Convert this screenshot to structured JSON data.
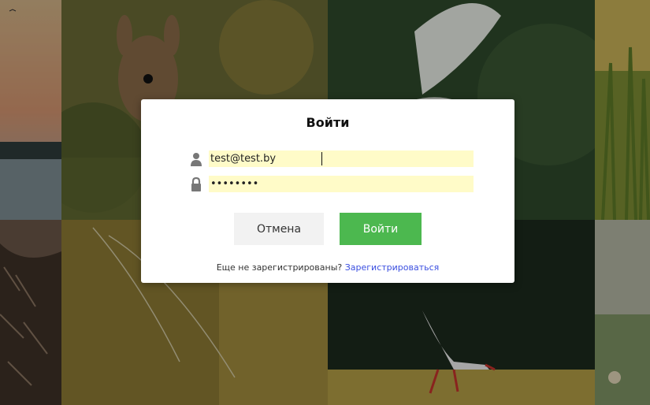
{
  "background": {
    "tile_colors": {
      "sunset_sky": "#c9a07a",
      "deer_meadow": "#6f6a3a",
      "forest_green": "#2f4a2a",
      "grass_light": "#8c9a3a",
      "hedgehog": "#4a3a2e",
      "dewy_web": "#a18a3a",
      "dark_forest": "#1f2a20",
      "field": "#b6a24a",
      "pale_meadow": "#b7bba6"
    }
  },
  "login_dialog": {
    "title": "Войти",
    "username": {
      "value": "test@test.by",
      "icon": "user-icon"
    },
    "password": {
      "value": "••••••••",
      "icon": "lock-icon"
    },
    "cancel_label": "Отмена",
    "submit_label": "Войти",
    "signup_prompt": "Еще не зарегистрированы?",
    "signup_link": "Зарегистрироваться"
  },
  "colors": {
    "autofill_bg": "#fffbc8",
    "submit_green": "#4cb84f",
    "cancel_gray": "#f2f2f2",
    "link_blue": "#3a4ee0"
  }
}
